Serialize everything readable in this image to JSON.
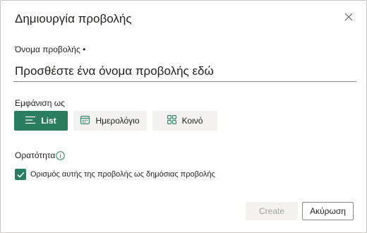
{
  "dialog": {
    "title": "Δημιουργία προβολής",
    "close_icon": "close-icon"
  },
  "name_field": {
    "label": "Όνομα προβολής •",
    "value": "",
    "placeholder": "Προσθέστε ένα όνομα προβολής εδώ"
  },
  "show_as": {
    "label": "Εμφάνιση ως",
    "options": [
      {
        "label": "List",
        "icon": "list-icon",
        "selected": true
      },
      {
        "label": "Ημερολόγιο",
        "icon": "calendar-icon",
        "selected": false
      },
      {
        "label": "Κοινό",
        "icon": "board-icon",
        "selected": false
      }
    ]
  },
  "visibility": {
    "label": "Ορατότητα",
    "info_icon": "info-icon",
    "checkbox_label": "Ορισμός αυτής της προβολής ως δημόσιας προβολής",
    "checked": true
  },
  "footer": {
    "create_label": "Create",
    "create_enabled": false,
    "cancel_label": "Ακύρωση"
  },
  "colors": {
    "accent": "#2a7d5f",
    "neutral_button": "#f3f2f1",
    "disabled_text": "#a19f9d",
    "border": "#8a8886"
  }
}
